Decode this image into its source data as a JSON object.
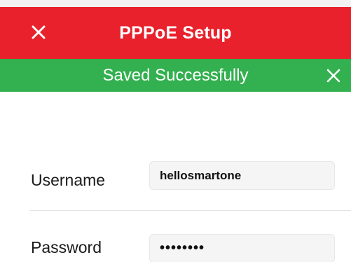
{
  "header": {
    "title": "PPPoE Setup",
    "background": "#e8212c",
    "close_icon": "close-icon"
  },
  "toast": {
    "message": "Saved Successfully",
    "background": "#33b04f",
    "close_icon": "close-icon"
  },
  "form": {
    "username": {
      "label": "Username",
      "value": "hellosmartone"
    },
    "password": {
      "label": "Password",
      "value": "••••••••"
    }
  }
}
